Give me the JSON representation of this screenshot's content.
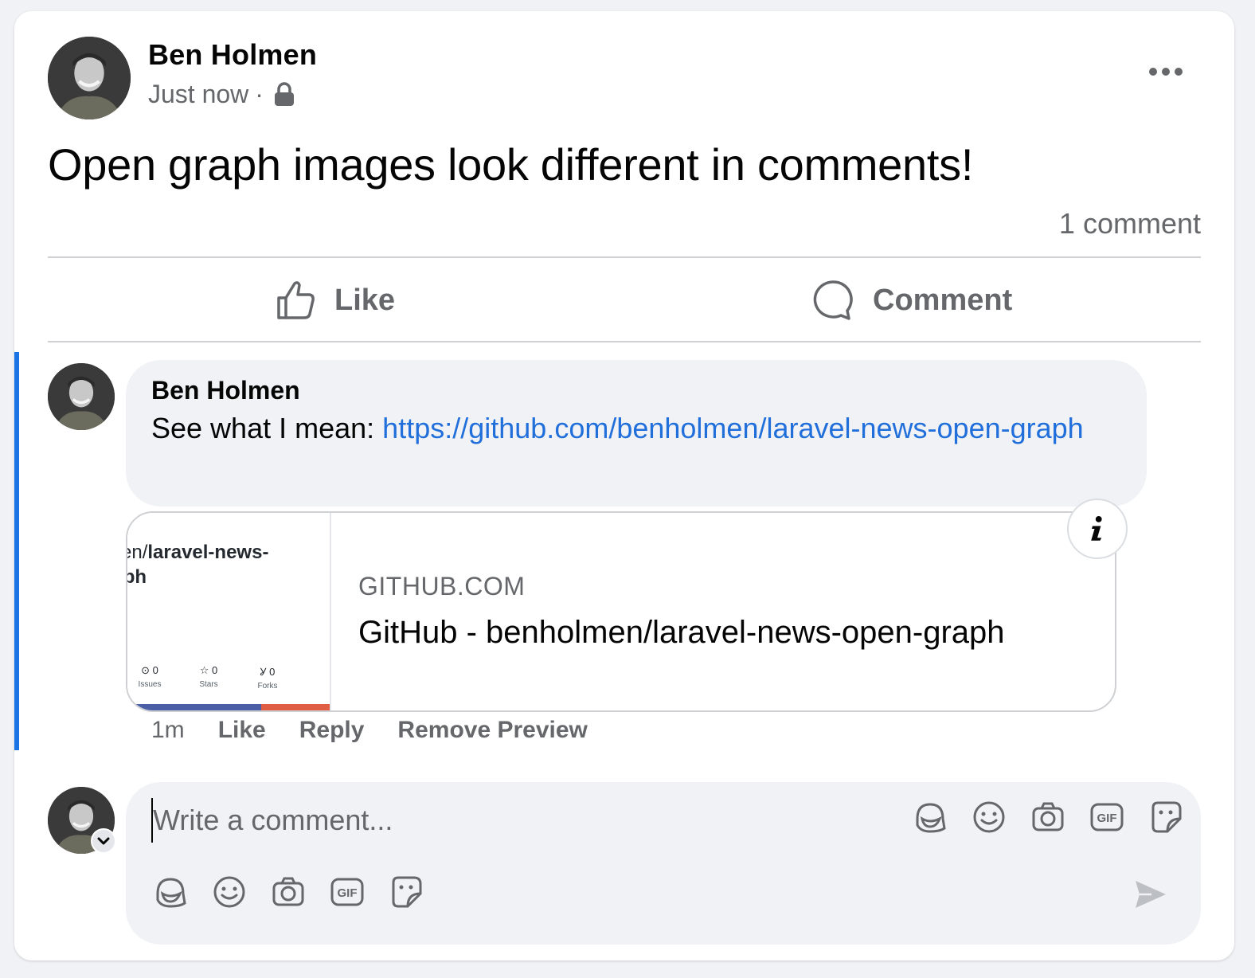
{
  "post": {
    "author": "Ben Holmen",
    "time": "Just now",
    "separator": "·",
    "audience_icon": "lock-icon",
    "text": "Open graph images look different in comments!",
    "comment_count": "1 comment"
  },
  "actions": {
    "like": "Like",
    "comment": "Comment"
  },
  "comment": {
    "author": "Ben Holmen",
    "text_prefix": "See what I mean: ",
    "link": "https://github.com/benholmen/laravel-news-open-graph",
    "time": "1m",
    "like": "Like",
    "reply": "Reply",
    "remove_preview": "Remove Preview"
  },
  "preview": {
    "thumb_title_plain": "men/",
    "thumb_title_bold": "laravel-news-",
    "thumb_title_line2": "raph",
    "stats": [
      {
        "icon": "issues-icon",
        "count": "0",
        "label": "Issues"
      },
      {
        "icon": "star-icon",
        "count": "0",
        "label": "Stars"
      },
      {
        "icon": "fork-icon",
        "count": "0",
        "label": "Forks"
      }
    ],
    "domain": "GITHUB.COM",
    "title": "GitHub - benholmen/laravel-news-open-graph"
  },
  "composer": {
    "placeholder": "Write a comment...",
    "top_tools": [
      "avatar-sticker-icon",
      "emoji-icon",
      "camera-icon",
      "gif-icon",
      "sticker-icon"
    ],
    "bottom_tools": [
      "avatar-sticker-icon",
      "emoji-icon",
      "camera-icon",
      "gif-icon",
      "sticker-icon"
    ],
    "send_icon": "send-icon"
  },
  "colors": {
    "accent": "#1b74e4",
    "link": "#216fdb",
    "secondary_text": "#65676b",
    "bubble_bg": "#f0f2f5"
  }
}
